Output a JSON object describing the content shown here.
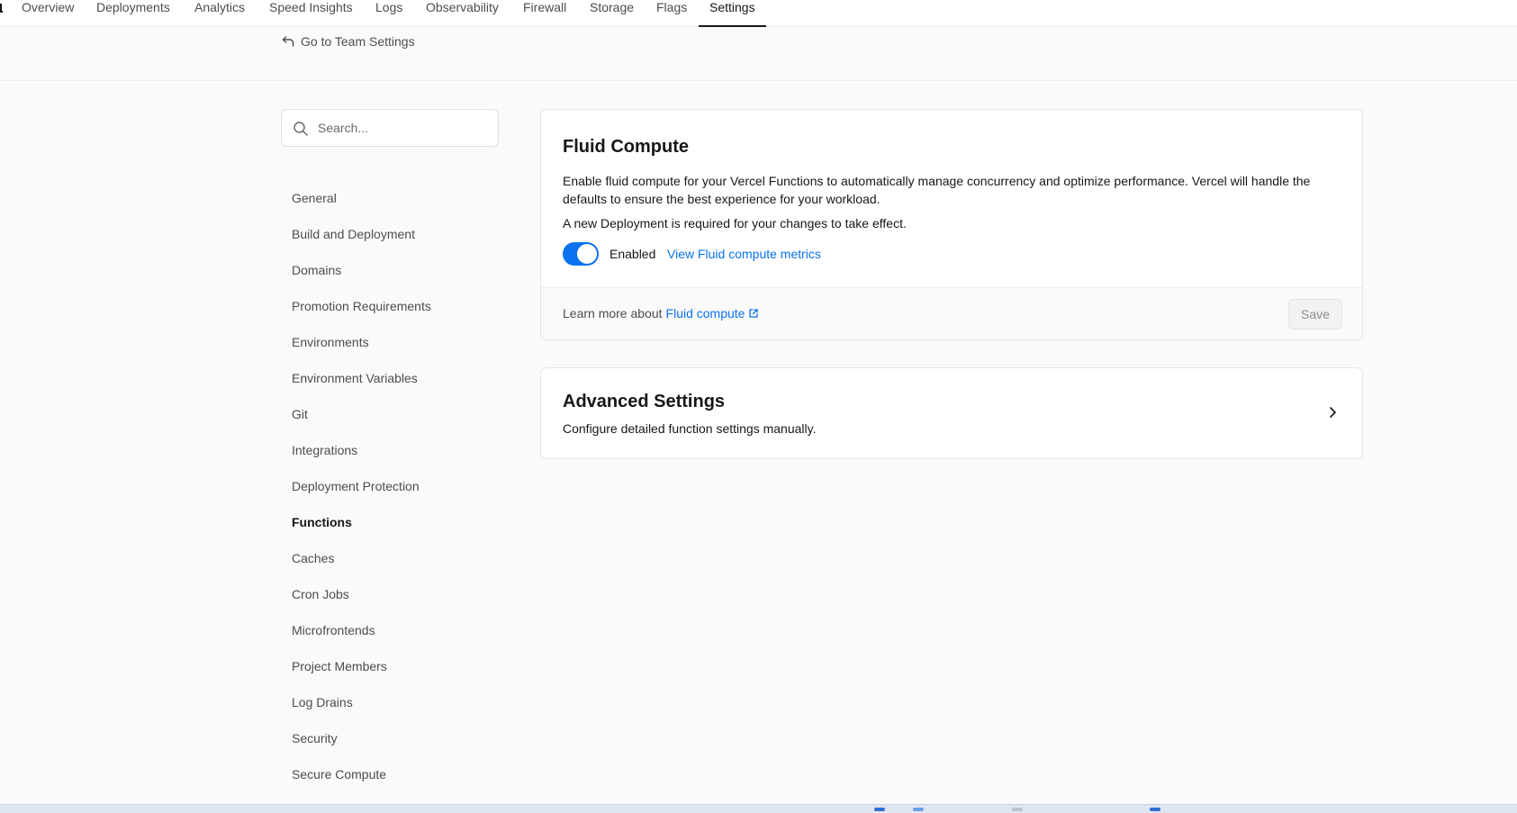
{
  "topnav": {
    "tabs": [
      {
        "label": "Overview"
      },
      {
        "label": "Deployments"
      },
      {
        "label": "Analytics"
      },
      {
        "label": "Speed Insights"
      },
      {
        "label": "Logs"
      },
      {
        "label": "Observability"
      },
      {
        "label": "Firewall"
      },
      {
        "label": "Storage"
      },
      {
        "label": "Flags"
      },
      {
        "label": "Settings"
      }
    ],
    "active_tab": "Settings"
  },
  "back_link": {
    "label": "Go to Team Settings"
  },
  "search": {
    "placeholder": "Search..."
  },
  "sidebar": {
    "items": [
      {
        "label": "General"
      },
      {
        "label": "Build and Deployment"
      },
      {
        "label": "Domains"
      },
      {
        "label": "Promotion Requirements"
      },
      {
        "label": "Environments"
      },
      {
        "label": "Environment Variables"
      },
      {
        "label": "Git"
      },
      {
        "label": "Integrations"
      },
      {
        "label": "Deployment Protection"
      },
      {
        "label": "Functions"
      },
      {
        "label": "Caches"
      },
      {
        "label": "Cron Jobs"
      },
      {
        "label": "Microfrontends"
      },
      {
        "label": "Project Members"
      },
      {
        "label": "Log Drains"
      },
      {
        "label": "Security"
      },
      {
        "label": "Secure Compute"
      }
    ],
    "active_item": "Functions"
  },
  "fluid_compute": {
    "title": "Fluid Compute",
    "description": "Enable fluid compute for your Vercel Functions to automatically manage concurrency and optimize performance. Vercel will handle the defaults to ensure the best experience for your workload.",
    "note": "A new Deployment is required for your changes to take effect.",
    "toggle_label": "Enabled",
    "toggle_on": true,
    "metrics_link": "View Fluid compute metrics",
    "footer_text": "Learn more about",
    "footer_link": "Fluid compute",
    "save_label": "Save"
  },
  "advanced": {
    "title": "Advanced Settings",
    "description": "Configure detailed function settings manually."
  },
  "colors": {
    "accent": "#0a72ef",
    "text": "#171717",
    "muted": "#4d4d4d",
    "background": "#fafafa"
  }
}
